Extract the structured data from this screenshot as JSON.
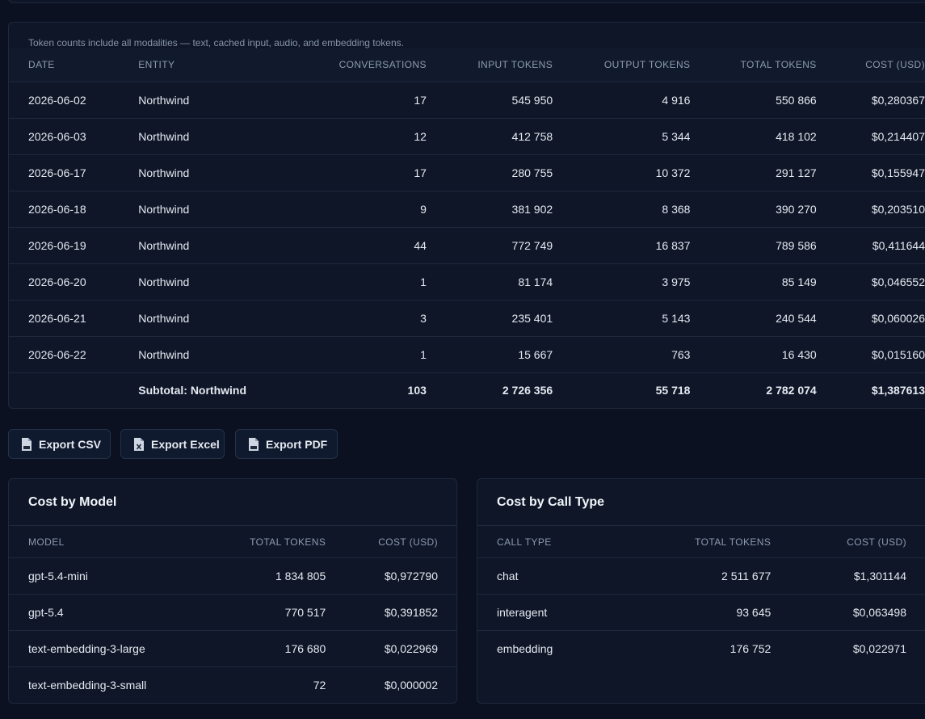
{
  "usage": {
    "note": "Token counts include all modalities — text, cached input, audio, and embedding tokens.",
    "columns": [
      "DATE",
      "ENTITY",
      "CONVERSATIONS",
      "INPUT TOKENS",
      "OUTPUT TOKENS",
      "TOTAL TOKENS",
      "COST (USD)"
    ],
    "rows": [
      [
        "2026-06-02",
        "Northwind",
        "17",
        "545 950",
        "4 916",
        "550 866",
        "$0,280367"
      ],
      [
        "2026-06-03",
        "Northwind",
        "12",
        "412 758",
        "5 344",
        "418 102",
        "$0,214407"
      ],
      [
        "2026-06-17",
        "Northwind",
        "17",
        "280 755",
        "10 372",
        "291 127",
        "$0,155947"
      ],
      [
        "2026-06-18",
        "Northwind",
        "9",
        "381 902",
        "8 368",
        "390 270",
        "$0,203510"
      ],
      [
        "2026-06-19",
        "Northwind",
        "44",
        "772 749",
        "16 837",
        "789 586",
        "$0,411644"
      ],
      [
        "2026-06-20",
        "Northwind",
        "1",
        "81 174",
        "3 975",
        "85 149",
        "$0,046552"
      ],
      [
        "2026-06-21",
        "Northwind",
        "3",
        "235 401",
        "5 143",
        "240 544",
        "$0,060026"
      ],
      [
        "2026-06-22",
        "Northwind",
        "1",
        "15 667",
        "763",
        "16 430",
        "$0,015160"
      ]
    ],
    "subtotal": [
      "",
      "Subtotal: Northwind",
      "103",
      "2 726 356",
      "55 718",
      "2 782 074",
      "$1,387613"
    ]
  },
  "exports": {
    "csv": "Export CSV",
    "excel": "Export Excel",
    "pdf": "Export PDF"
  },
  "by_model": {
    "title": "Cost by Model",
    "columns": [
      "MODEL",
      "TOTAL TOKENS",
      "COST (USD)"
    ],
    "rows": [
      [
        "gpt-5.4-mini",
        "1 834 805",
        "$0,972790"
      ],
      [
        "gpt-5.4",
        "770 517",
        "$0,391852"
      ],
      [
        "text-embedding-3-large",
        "176 680",
        "$0,022969"
      ],
      [
        "text-embedding-3-small",
        "72",
        "$0,000002"
      ]
    ]
  },
  "by_call_type": {
    "title": "Cost by Call Type",
    "columns": [
      "CALL TYPE",
      "TOTAL TOKENS",
      "COST (USD)"
    ],
    "rows": [
      [
        "chat",
        "2 511 677",
        "$1,301144"
      ],
      [
        "interagent",
        "93 645",
        "$0,063498"
      ],
      [
        "embedding",
        "176 752",
        "$0,022971"
      ]
    ]
  },
  "icons": {
    "csv": "file-csv-icon",
    "excel": "file-excel-icon",
    "pdf": "file-pdf-icon"
  },
  "colors": {
    "background": "#0b1120",
    "panel": "#0e1628",
    "border": "#1e293b",
    "header_text": "#8d9ab0"
  }
}
